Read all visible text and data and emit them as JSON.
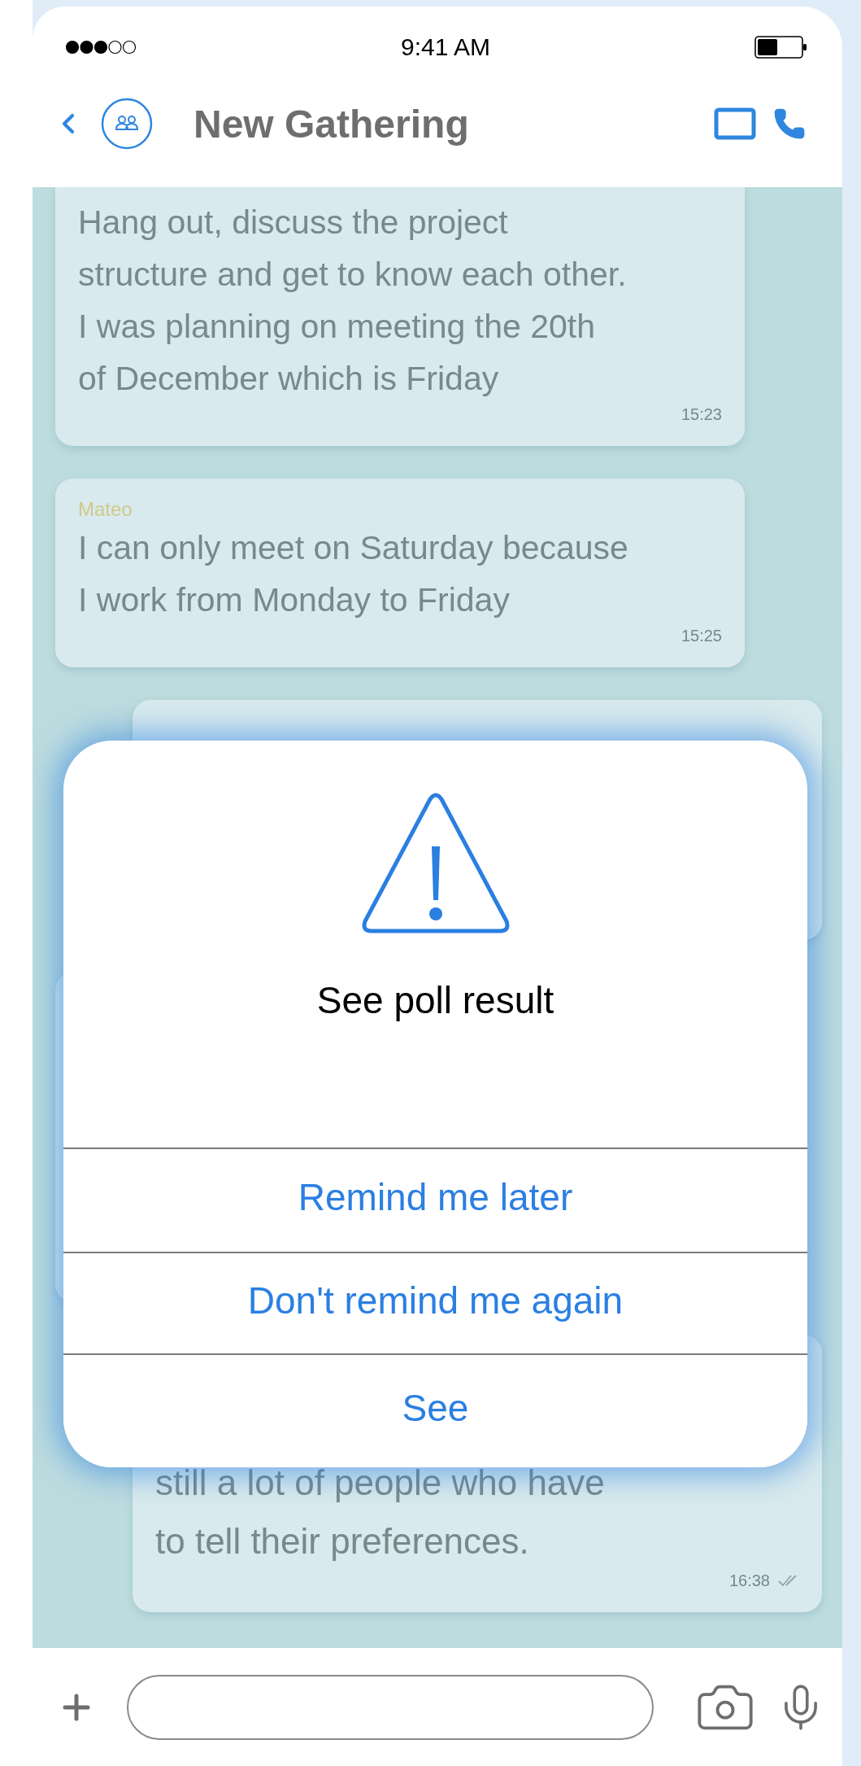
{
  "status_bar": {
    "time": "9:41 AM"
  },
  "header": {
    "title": "New Gathering"
  },
  "messages": [
    {
      "kind": "incoming",
      "text": "Hang out, discuss the project\nstructure and get to know each other.\nI was planning on meeting the 20th\nof December which is Friday",
      "time": "15:23"
    },
    {
      "kind": "incoming",
      "sender": "Mateo",
      "text": "I can only meet on Saturday because\nI work from Monday to Friday",
      "time": "15:25"
    },
    {
      "kind": "outgoing"
    },
    {
      "kind": "incoming"
    },
    {
      "kind": "outgoing",
      "text": "still a lot of people who have\nto tell their preferences.",
      "time": "16:38",
      "read": true
    }
  ],
  "dialog": {
    "title": "See poll result",
    "actions": [
      "Remind me later",
      "Don't remind me again",
      "See"
    ]
  }
}
